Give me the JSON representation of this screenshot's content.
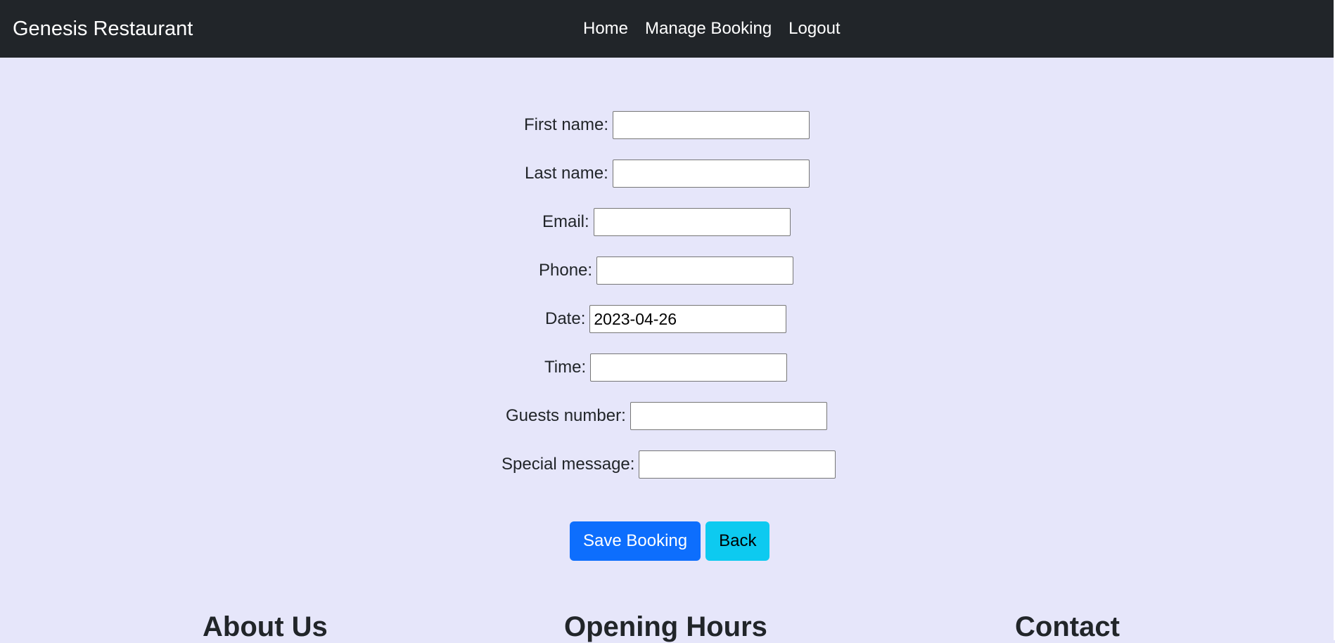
{
  "navbar": {
    "brand": "Genesis Restaurant",
    "links": [
      "Home",
      "Manage Booking",
      "Logout"
    ]
  },
  "form": {
    "fields": [
      {
        "label": "First name:",
        "value": ""
      },
      {
        "label": "Last name:",
        "value": ""
      },
      {
        "label": "Email:",
        "value": ""
      },
      {
        "label": "Phone:",
        "value": ""
      },
      {
        "label": "Date:",
        "value": "2023-04-26"
      },
      {
        "label": "Time:",
        "value": ""
      },
      {
        "label": "Guests number:",
        "value": ""
      },
      {
        "label": "Special message:",
        "value": ""
      }
    ],
    "save_label": "Save Booking",
    "back_label": "Back"
  },
  "footer": {
    "about": "About Us",
    "hours": "Opening Hours",
    "contact": "Contact"
  },
  "colors": {
    "navbar_bg": "#212529",
    "page_bg": "#e6e6fa",
    "primary": "#0d6efd",
    "info": "#0dcaf0"
  }
}
